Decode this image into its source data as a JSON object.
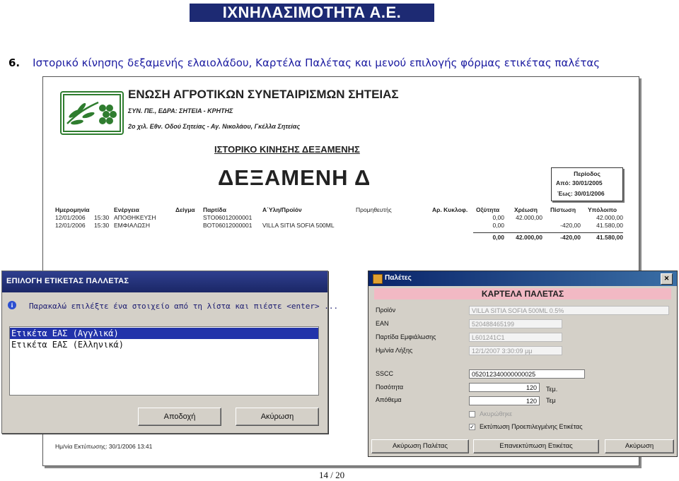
{
  "header": {
    "banner": "ΙΧΝΗΛΑΣΙΜΟΤΗΤΑ Α.Ε.",
    "section_number": "6.",
    "section_title": "Ιστορικό κίνησης δεξαμενής ελαιολάδου, Καρτέλα Παλέτας και μενού επιλογής φόρμας ετικέτας παλέτας"
  },
  "report": {
    "org_name": "ΕΝΩΣΗ ΑΓΡΟΤΙΚΩΝ ΣΥΝΕΤΑΙΡΙΣΜΩΝ ΣΗΤΕΙΑΣ",
    "org_line1": "ΣΥΝ. ΠΕ., ΕΔΡΑ: ΣΗΤΕΙΑ - ΚΡΗΤΗΣ",
    "org_line2": "2ο χιλ. Εθν. Οδού Σητείας - Αγ. Νικολάου, Γκέλλα Σητείας",
    "subtitle": "ΙΣΤΟΡΙΚΟ ΚΙΝΗΣΗΣ ΔΕΞΑΜΕΝΗΣ",
    "tank": "ΔΕΞΑΜΕΝΗ Δ",
    "period": {
      "label": "Περίοδος",
      "from": "Από:  30/01/2005",
      "to": "Έως:  30/01/2006"
    },
    "columns": [
      "Ημερομηνία",
      "Ενέργεια",
      "Δείγμα",
      "Παρτίδα",
      "Α΄Υλη/Προϊόν",
      "Προμηθευτής",
      "Αρ. Κυκλοφ.",
      "Οξύτητα",
      "Χρέωση",
      "Πίστωση",
      "Υπόλοιπο"
    ],
    "rows": [
      {
        "date": "12/01/2006",
        "time": "15:30",
        "action": "ΑΠΟΘΗΚΕΥΣΗ",
        "batch": "STO06012000001",
        "product": "",
        "acidity": "0,00",
        "debit": "42.000,00",
        "credit": "",
        "balance": "42.000,00"
      },
      {
        "date": "12/01/2006",
        "time": "15:30",
        "action": "ΕΜΦΙΑΛΩΣΗ",
        "batch": "BOT06012000001",
        "product": "VILLA SITIA SOFIA 500ML",
        "acidity": "0,00",
        "debit": "",
        "credit": "-420,00",
        "balance": "41.580,00"
      }
    ],
    "totals": {
      "acidity": "0,00",
      "debit": "42.000,00",
      "credit": "-420,00",
      "balance": "41.580,00"
    },
    "print_date": "Ημ/νία Εκτύπωσης: 30/1/2006 13:41"
  },
  "select_dialog": {
    "title": "ΕΠΙΛΟΓΗ ΕΤΙΚΕΤΑΣ ΠΑΛΛΕΤΑΣ",
    "prompt": "Παρακαλώ επιλέξτε ένα στοιχείο από τη λίστα και πιέστε <enter> ...",
    "items": [
      "Ετικέτα ΕΑΣ (Αγγλικά)",
      "Ετικέτα ΕΑΣ (Ελληνικά)"
    ],
    "ok_label": "Αποδοχή",
    "cancel_label": "Ακύρωση"
  },
  "pallet_dialog": {
    "title": "Παλέτες",
    "close": "✕",
    "header": "ΚΑΡΤΕΛΑ ΠΑΛΕΤΑΣ",
    "fields": {
      "product_label": "Προϊόν",
      "product_value": "VILLA SITIA SOFIA 500ML 0.5%",
      "ean_label": "EAN",
      "ean_value": "520488465199",
      "batch_label": "Παρτίδα Εμφιάλωσης",
      "batch_value": "L601241C1",
      "expiry_label": "Ημ/νία Λήξης",
      "expiry_value": "12/1/2007 3:30:09 μμ",
      "sscc_label": "SSCC",
      "sscc_value": "052012340000000025",
      "qty_label": "Ποσότητα",
      "qty_value": "120",
      "qty_unit": "Τεμ.",
      "stock_label": "Απόθεμα",
      "stock_value": "120",
      "stock_unit": "Τεμ"
    },
    "checks": {
      "cancelled_label": "Ακυρώθηκε",
      "print_label": "Εκτύπωση Προεπιλεγμένης Ετικέτας",
      "print_mark": "✓"
    },
    "buttons": {
      "cancel_pallet": "Ακύρωση Παλέτας",
      "reprint": "Επανεκτύπωση Ετικέτας",
      "cancel": "Ακύρωση"
    }
  },
  "page_number": "14 / 20"
}
